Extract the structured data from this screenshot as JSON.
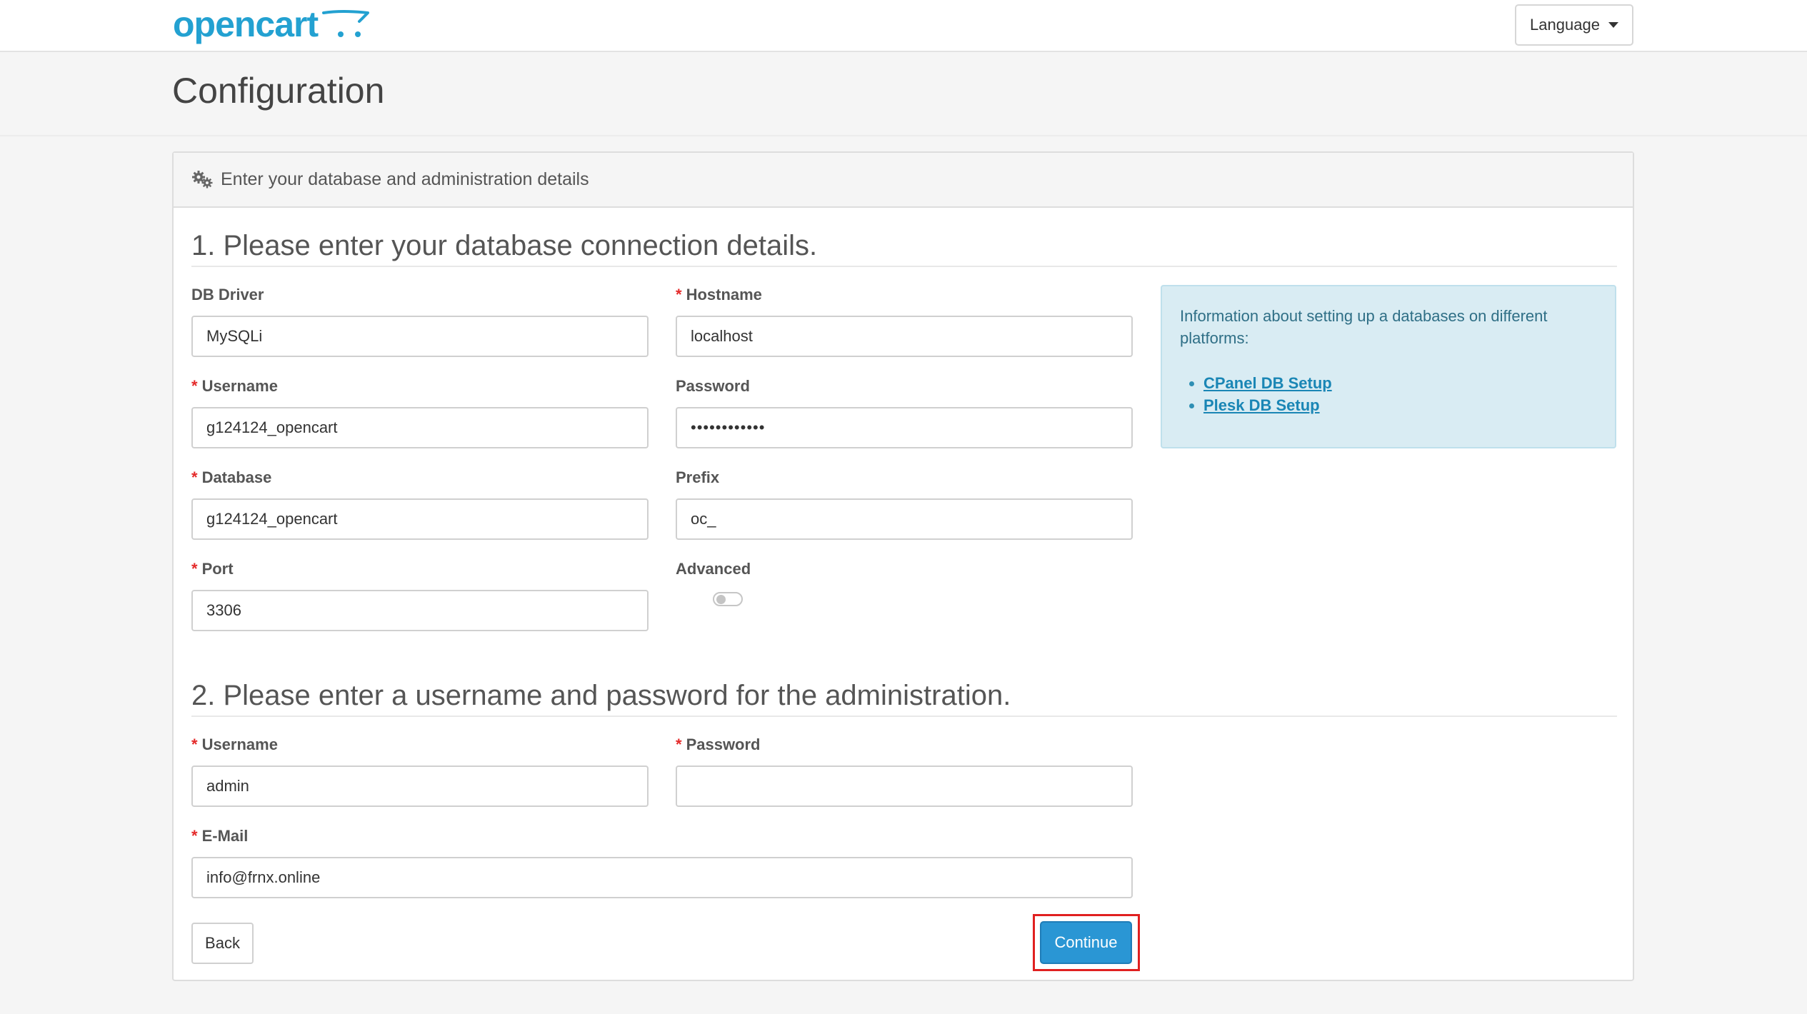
{
  "header": {
    "logo_text": "opencart",
    "language_label": "Language"
  },
  "page": {
    "title": "Configuration"
  },
  "panel": {
    "heading": "Enter your database and administration details",
    "section1_title": "1. Please enter your database connection details.",
    "section2_title": "2. Please enter a username and password for the administration."
  },
  "db": {
    "driver_label": "DB Driver",
    "driver_value": "MySQLi",
    "hostname_label": "Hostname",
    "hostname_value": "localhost",
    "username_label": "Username",
    "username_value": "g124124_opencart",
    "password_label": "Password",
    "password_value": "••••••••••••",
    "database_label": "Database",
    "database_value": "g124124_opencart",
    "prefix_label": "Prefix",
    "prefix_value": "oc_",
    "port_label": "Port",
    "port_value": "3306",
    "advanced_label": "Advanced",
    "advanced_enabled": false
  },
  "info": {
    "text": "Information about setting up a databases on different platforms:",
    "links": [
      "CPanel DB Setup",
      "Plesk DB Setup"
    ]
  },
  "admin": {
    "username_label": "Username",
    "username_value": "admin",
    "password_label": "Password",
    "password_value": "",
    "email_label": "E-Mail",
    "email_value": "info@frnx.online"
  },
  "required_marker": "*",
  "buttons": {
    "back": "Back",
    "continue": "Continue"
  },
  "colors": {
    "brand": "#23a1d1",
    "primary_button": "#2a96d4",
    "required": "#e42a2a",
    "info_bg": "#d9ecf3",
    "highlight": "#e02020"
  },
  "icons": {
    "heading": "gears-icon",
    "language": "caret-down-icon"
  }
}
